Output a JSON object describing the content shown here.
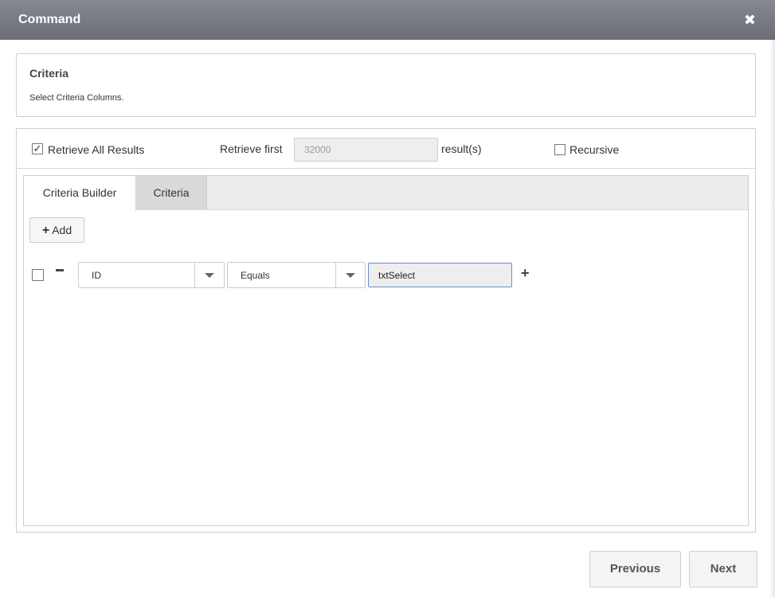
{
  "dialog": {
    "title": "Command",
    "close_glyph": "✖"
  },
  "header": {
    "title": "Criteria",
    "subtitle": "Select Criteria Columns."
  },
  "options": {
    "retrieve_all": {
      "label": "Retrieve All Results",
      "checked": true
    },
    "retrieve_first_label": "Retrieve first",
    "retrieve_first_value": "32000",
    "results_suffix": "result(s)",
    "recursive": {
      "label": "Recursive",
      "checked": false
    }
  },
  "tabs": [
    {
      "label": "Criteria Builder",
      "active": true
    },
    {
      "label": "Criteria",
      "active": false
    }
  ],
  "builder": {
    "add_label": "Add",
    "rule": {
      "checked": false,
      "field": "ID",
      "operator": "Equals",
      "value": "txtSelect"
    }
  },
  "footer": {
    "previous_label": "Previous",
    "next_label": "Next"
  },
  "icons": {
    "check": "check-icon",
    "close": "close-icon",
    "plus": "plus-icon",
    "minus": "minus-icon",
    "dropdown": "chevron-down-icon"
  }
}
